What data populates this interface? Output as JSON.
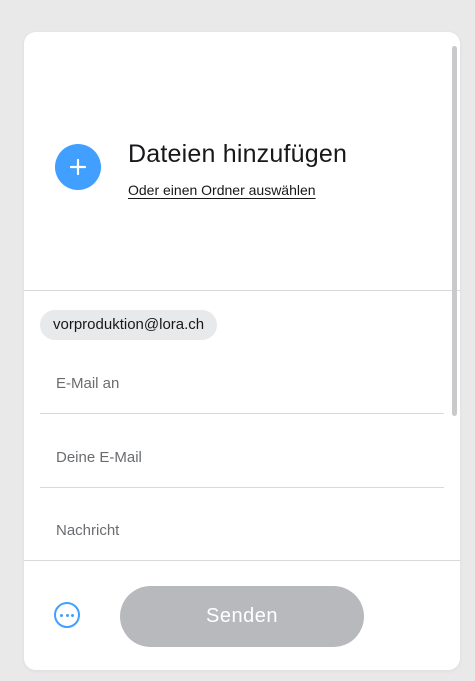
{
  "upload": {
    "title": "Dateien hinzufügen",
    "folder_link": "Oder einen Ordner auswählen"
  },
  "recipients": {
    "chip": "vorproduktion@lora.ch",
    "email_to_placeholder": "E-Mail an",
    "email_from_placeholder": "Deine E-Mail",
    "message_placeholder": "Nachricht"
  },
  "footer": {
    "send_label": "Senden"
  },
  "colors": {
    "accent": "#409fff",
    "button_disabled": "#b8b9bc",
    "background": "#e9e9ea"
  },
  "icons": {
    "add": "plus-icon",
    "more": "ellipsis-circle-icon"
  }
}
